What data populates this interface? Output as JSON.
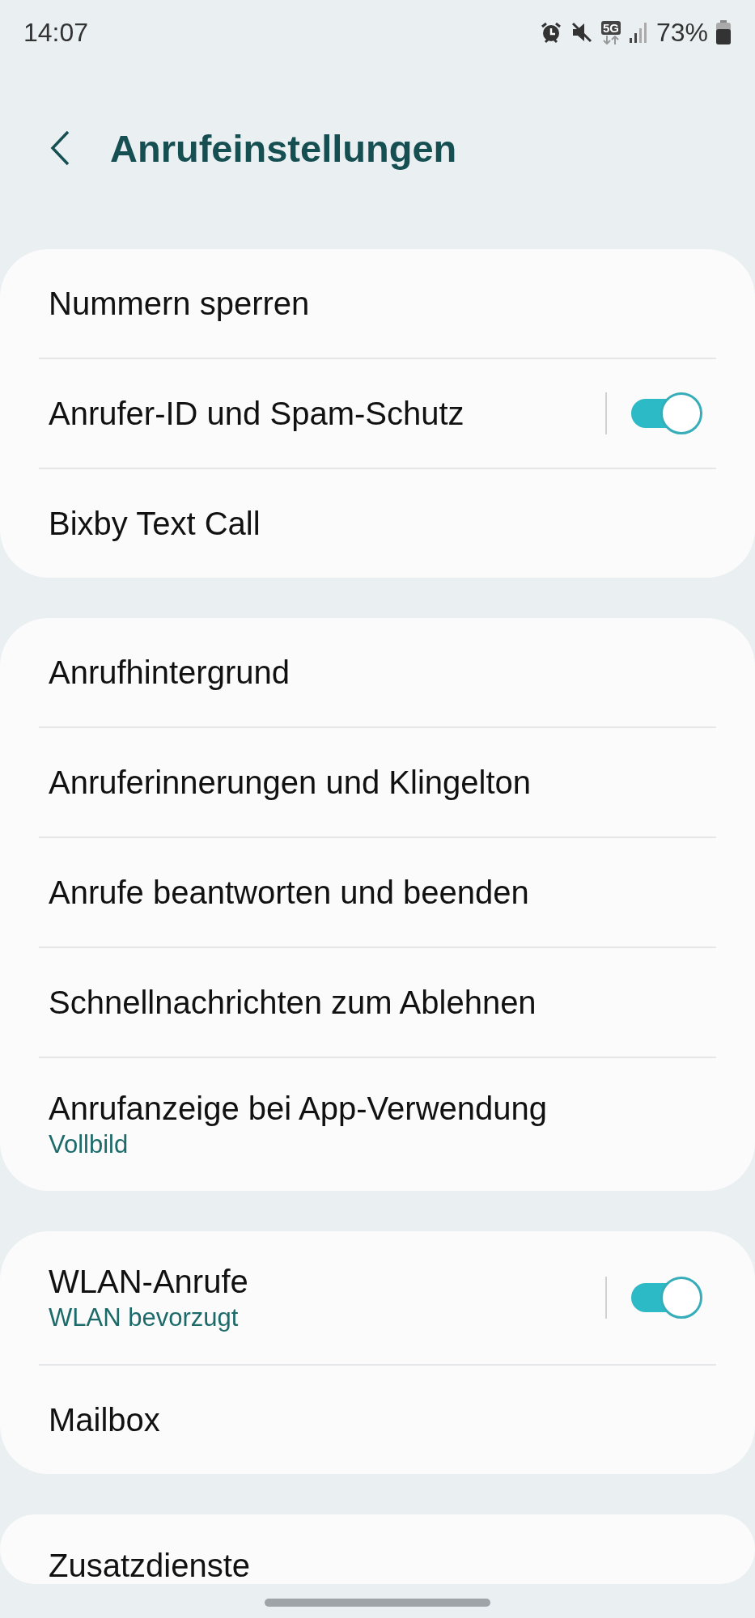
{
  "status_bar": {
    "time": "14:07",
    "network": "5G",
    "battery": "73%"
  },
  "header": {
    "title": "Anrufeinstellungen"
  },
  "sections": [
    {
      "items": [
        {
          "kind": "link",
          "label": "Nummern sperren"
        },
        {
          "kind": "switch",
          "label": "Anrufer-ID und Spam-Schutz",
          "on": true
        },
        {
          "kind": "link",
          "label": "Bixby Text Call"
        }
      ]
    },
    {
      "items": [
        {
          "kind": "link",
          "label": "Anrufhintergrund"
        },
        {
          "kind": "link",
          "label": "Anruferinnerungen und Klingelton"
        },
        {
          "kind": "link",
          "label": "Anrufe beantworten und beenden"
        },
        {
          "kind": "link",
          "label": "Schnellnachrichten zum Ablehnen"
        },
        {
          "kind": "link",
          "label": "Anrufanzeige bei App-Verwendung",
          "subtitle": "Vollbild"
        }
      ]
    },
    {
      "items": [
        {
          "kind": "switch",
          "label": "WLAN-Anrufe",
          "subtitle": "WLAN bevorzugt",
          "on": true
        },
        {
          "kind": "link",
          "label": "Mailbox"
        }
      ]
    },
    {
      "items": [
        {
          "kind": "link",
          "label": "Zusatzdienste"
        }
      ]
    }
  ]
}
